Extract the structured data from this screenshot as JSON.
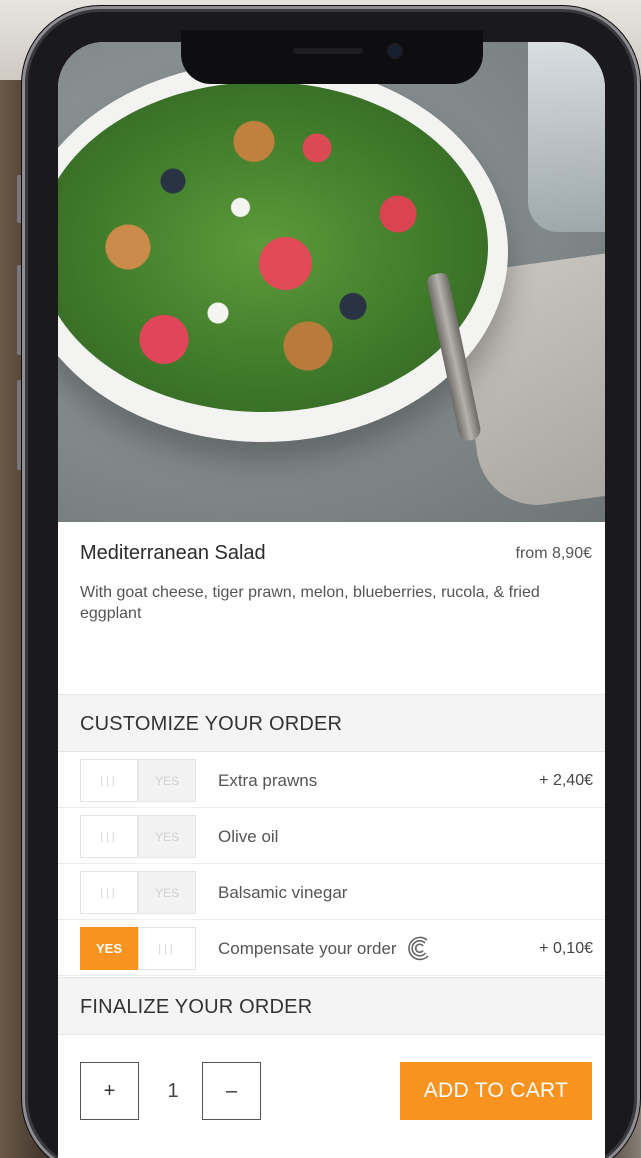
{
  "dish": {
    "title": "Mediterranean Salad",
    "price": "from 8,90€",
    "description": "With goat cheese, tiger prawn, melon, blueberries, rucola, & fried eggplant"
  },
  "customize": {
    "heading": "CUSTOMIZE YOUR ORDER",
    "options": [
      {
        "label": "Extra prawns",
        "price": "+ 2,40€",
        "toggle_label": "YES",
        "selected": false
      },
      {
        "label": "Olive oil",
        "price": "",
        "toggle_label": "YES",
        "selected": false
      },
      {
        "label": "Balsamic vinegar",
        "price": "",
        "toggle_label": "YES",
        "selected": false
      },
      {
        "label": "Compensate your order",
        "price": "+ 0,10€",
        "toggle_label": "YES",
        "selected": true,
        "icon": "eco-leaf-icon"
      }
    ]
  },
  "finalize": {
    "heading": "FINALIZE YOUR ORDER",
    "plus_label": "+",
    "quantity": "1",
    "minus_label": "–",
    "add_to_cart_label": "ADD TO CART"
  },
  "colors": {
    "accent": "#f7931e"
  }
}
